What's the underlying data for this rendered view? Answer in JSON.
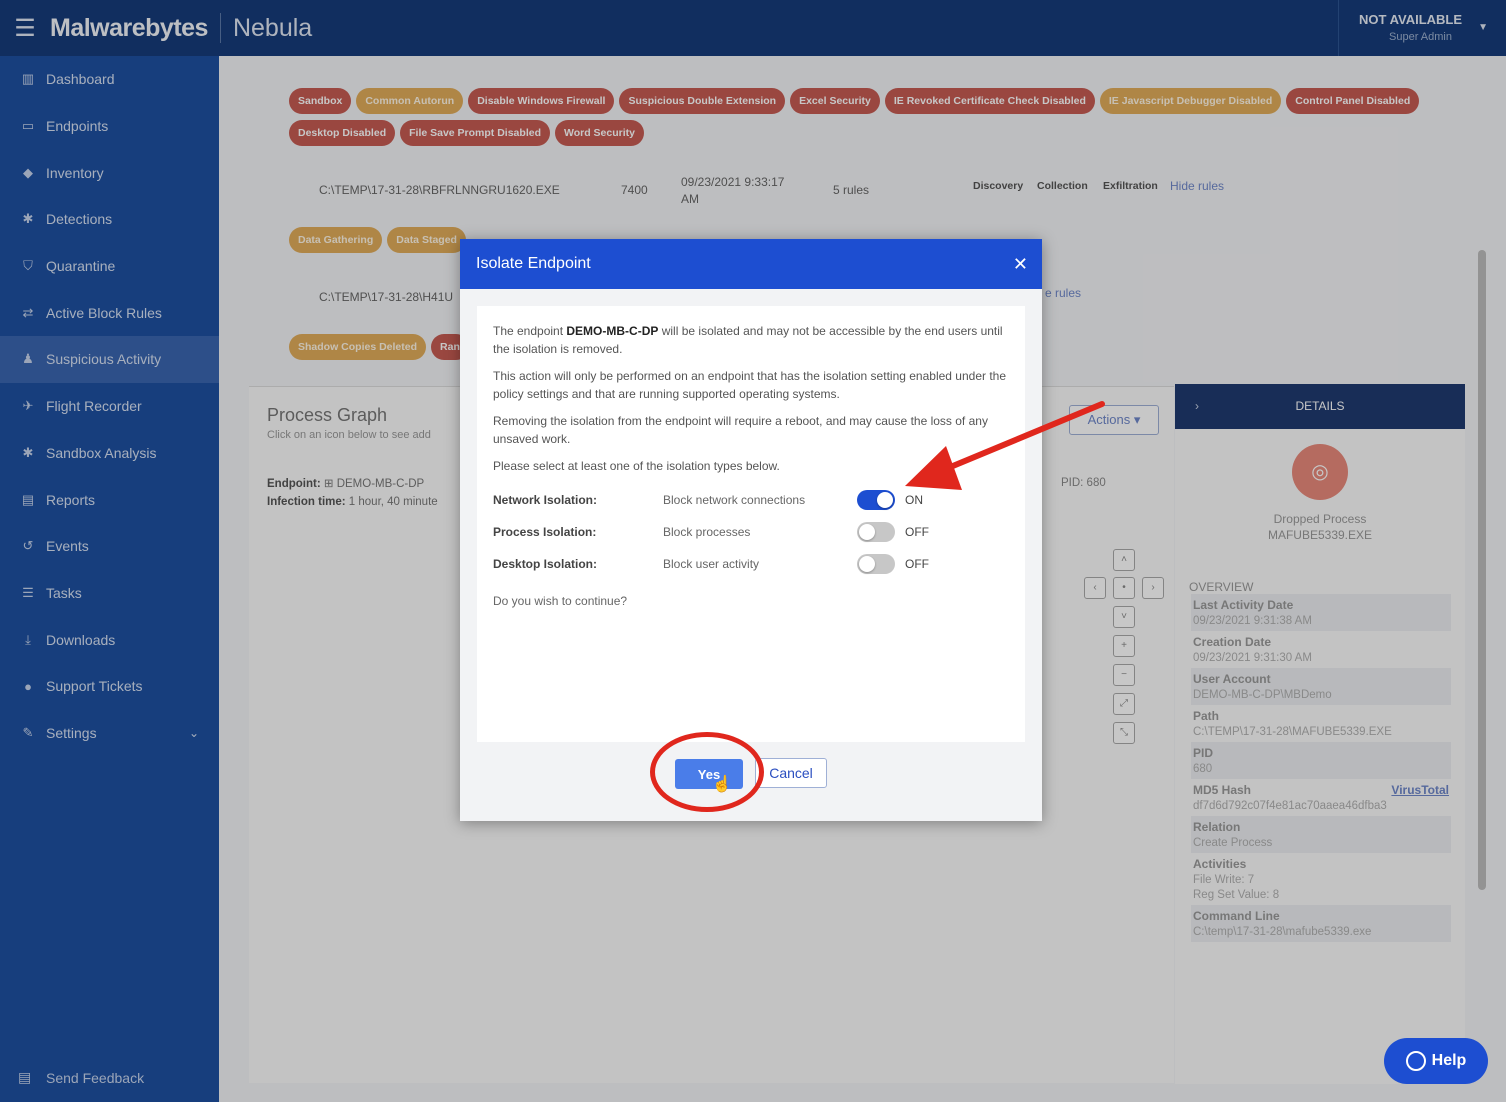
{
  "app": {
    "brand": "Malwarebytes",
    "product": "Nebula",
    "user_name": "NOT AVAILABLE",
    "user_role": "Super Admin"
  },
  "sidebar": {
    "items": [
      {
        "label": "Dashboard",
        "icon": "chart-icon"
      },
      {
        "label": "Endpoints",
        "icon": "monitor-icon"
      },
      {
        "label": "Inventory",
        "icon": "tag-icon"
      },
      {
        "label": "Detections",
        "icon": "bug-icon"
      },
      {
        "label": "Quarantine",
        "icon": "shield-icon"
      },
      {
        "label": "Active Block Rules",
        "icon": "arrows-icon"
      },
      {
        "label": "Suspicious Activity",
        "icon": "person-icon"
      },
      {
        "label": "Flight Recorder",
        "icon": "plane-icon"
      },
      {
        "label": "Sandbox Analysis",
        "icon": "bug-icon"
      },
      {
        "label": "Reports",
        "icon": "document-icon"
      },
      {
        "label": "Events",
        "icon": "history-icon"
      },
      {
        "label": "Tasks",
        "icon": "list-icon"
      },
      {
        "label": "Downloads",
        "icon": "download-icon"
      },
      {
        "label": "Support Tickets",
        "icon": "chat-icon"
      },
      {
        "label": "Settings",
        "icon": "wrench-icon"
      }
    ],
    "active": "Suspicious Activity",
    "feedback": "Send Feedback"
  },
  "background": {
    "tags_row1": [
      {
        "label": "Sandbox",
        "color": "red"
      },
      {
        "label": "Common Autorun",
        "color": "orange"
      },
      {
        "label": "Disable Windows Firewall",
        "color": "red"
      },
      {
        "label": "Suspicious Double Extension",
        "color": "red"
      },
      {
        "label": "Excel Security",
        "color": "red"
      },
      {
        "label": "IE Revoked Certificate Check Disabled",
        "color": "red"
      },
      {
        "label": "IE Javascript Debugger Disabled",
        "color": "orange"
      },
      {
        "label": "Control Panel Disabled",
        "color": "red"
      }
    ],
    "tags_row2": [
      {
        "label": "Desktop Disabled",
        "color": "red"
      },
      {
        "label": "File Save Prompt Disabled",
        "color": "red"
      },
      {
        "label": "Word Security",
        "color": "red"
      }
    ],
    "proc1": {
      "path": "C:\\TEMP\\17-31-28\\RBFRLNNGRU1620.EXE",
      "pid": "7400",
      "date_line1": "09/23/2021 9:33:17",
      "date_line2": "AM",
      "rules": "5 rules",
      "tactics": [
        "Discovery",
        "Collection",
        "Exfiltration"
      ],
      "hide": "Hide rules"
    },
    "tags_row3": [
      {
        "label": "Data Gathering",
        "color": "orange"
      },
      {
        "label": "Data Staged",
        "color": "orange"
      }
    ],
    "proc2": {
      "path": "C:\\TEMP\\17-31-28\\H41U",
      "hide_tail": "e rules"
    },
    "tags_row4": [
      {
        "label": "Shadow Copies Deleted",
        "color": "orange"
      },
      {
        "label": "Ran",
        "color": "red"
      }
    ],
    "graph": {
      "title": "Process Graph",
      "subtitle": "Click on an icon below to see add",
      "endpoint_label": "Endpoint:",
      "endpoint_value": "DEMO-MB-C-DP",
      "infection_label": "Infection time:",
      "infection_value": "1 hour, 40 minute",
      "pid": "PID: 680",
      "actions": "Actions"
    },
    "details": {
      "title": "DETAILS",
      "process_type": "Dropped Process",
      "process_name": "MAFUBE5339.EXE",
      "overview": "OVERVIEW",
      "fields": [
        {
          "k": "Last Activity Date",
          "v": "09/23/2021 9:31:38 AM"
        },
        {
          "k": "Creation Date",
          "v": "09/23/2021 9:31:30 AM"
        },
        {
          "k": "User Account",
          "v": "DEMO-MB-C-DP\\MBDemo"
        },
        {
          "k": "Path",
          "v": "C:\\TEMP\\17-31-28\\MAFUBE5339.EXE"
        },
        {
          "k": "PID",
          "v": "680"
        },
        {
          "k": "MD5 Hash",
          "v": "df7d6d792c07f4e81ac70aaea46dfba3"
        },
        {
          "k": "Relation",
          "v": "Create Process"
        },
        {
          "k": "Activities",
          "v": "File Write: 7"
        },
        {
          "k": "",
          "v": "Reg Set Value: 8"
        },
        {
          "k": "Command Line",
          "v": "C:\\temp\\17-31-28\\mafube5339.exe"
        }
      ],
      "virustotal": "VirusTotal"
    }
  },
  "modal": {
    "title": "Isolate Endpoint",
    "p1_pre": "The endpoint ",
    "p1_endpoint": "DEMO-MB-C-DP",
    "p1_post": " will be isolated and may not be accessible by the end users until the isolation is removed.",
    "p2": "This action will only be performed on an endpoint that has the isolation setting enabled under the policy settings and that are running supported operating systems.",
    "p3": "Removing the isolation from the endpoint will require a reboot, and may cause the loss of any unsaved work.",
    "p4": "Please select at least one of the isolation types below.",
    "options": [
      {
        "label": "Network Isolation:",
        "desc": "Block network connections",
        "state": "ON",
        "on": true
      },
      {
        "label": "Process Isolation:",
        "desc": "Block processes",
        "state": "OFF",
        "on": false
      },
      {
        "label": "Desktop Isolation:",
        "desc": "Block user activity",
        "state": "OFF",
        "on": false
      }
    ],
    "question": "Do you wish to continue?",
    "yes": "Yes",
    "cancel": "Cancel"
  },
  "help": "Help",
  "colors": {
    "topbar": "#163c7a",
    "sidebar": "#1e50a0",
    "modal_header": "#1d4ed1",
    "annotation": "#e0271d"
  }
}
